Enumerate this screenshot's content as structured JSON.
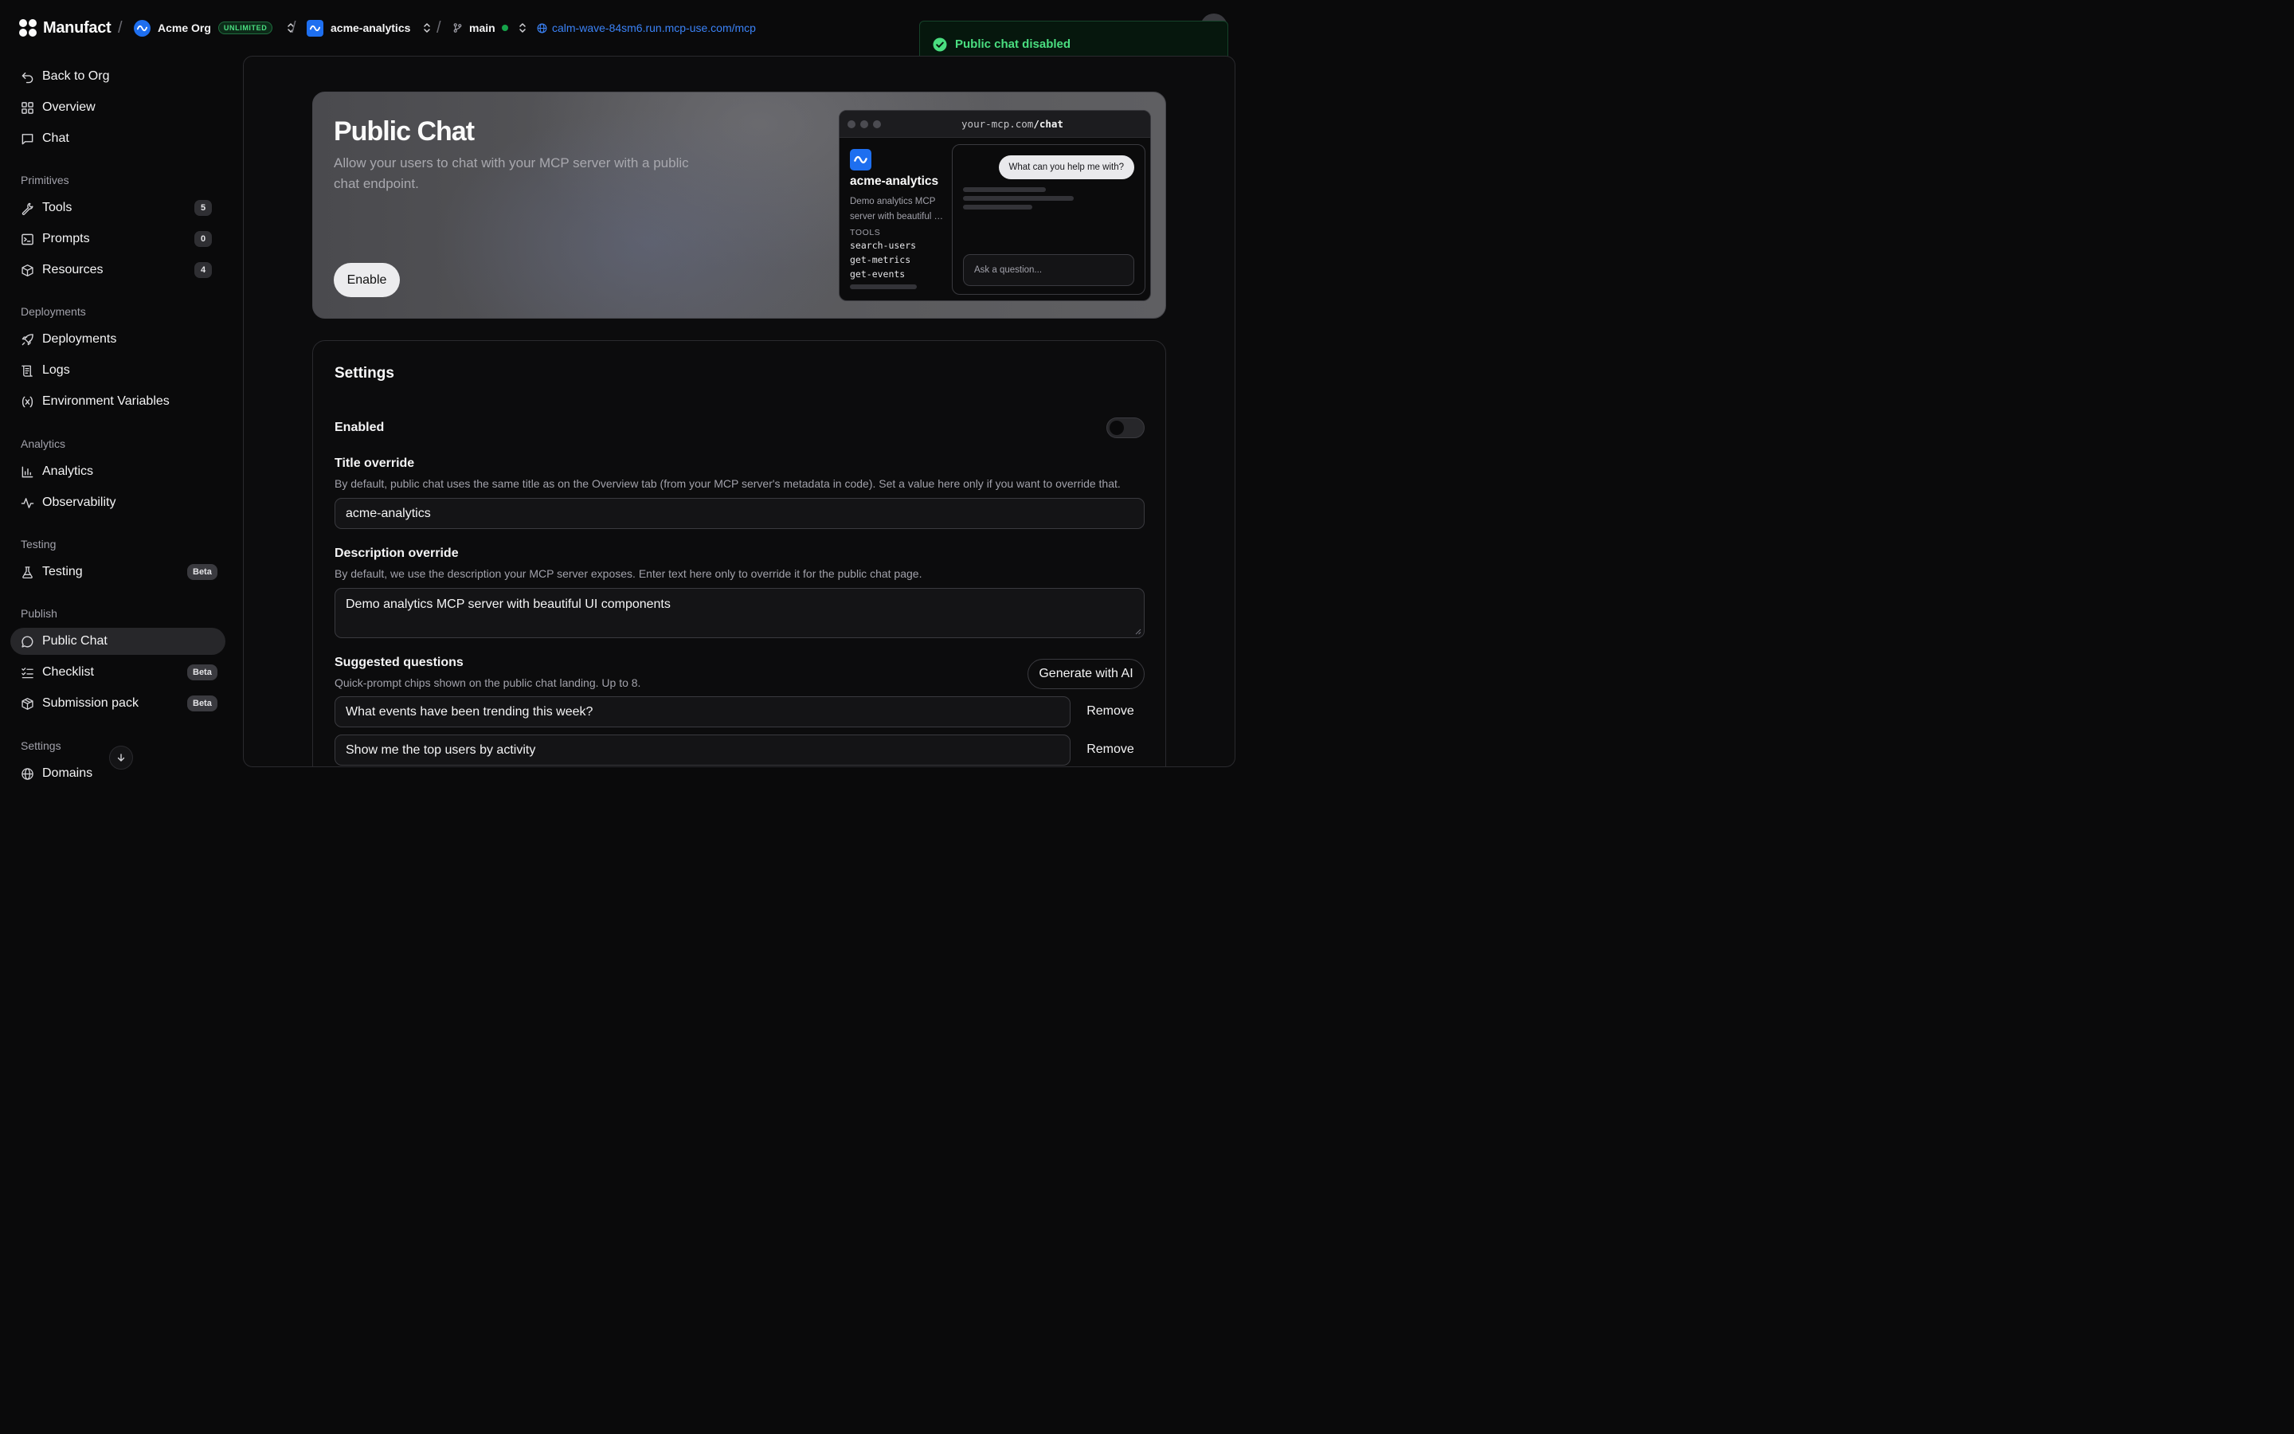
{
  "topbar": {
    "brand": "Manufact",
    "org_name": "Acme Org",
    "plan_badge": "UNLIMITED",
    "project_name": "acme-analytics",
    "branch": "main",
    "server_url": "calm-wave-84sm6.run.mcp-use.com/mcp"
  },
  "toast": {
    "message": "Public chat disabled"
  },
  "sidebar": {
    "top_items": [
      {
        "label": "Back to Org",
        "icon": "back-arrow-icon"
      },
      {
        "label": "Overview",
        "icon": "grid-icon"
      },
      {
        "label": "Chat",
        "icon": "chat-square-icon"
      }
    ],
    "primitives": {
      "heading": "Primitives",
      "items": [
        {
          "label": "Tools",
          "count": "5",
          "icon": "wrench-icon"
        },
        {
          "label": "Prompts",
          "count": "0",
          "icon": "terminal-icon"
        },
        {
          "label": "Resources",
          "count": "4",
          "icon": "box-icon"
        }
      ]
    },
    "deployments": {
      "heading": "Deployments",
      "items": [
        {
          "label": "Deployments",
          "icon": "rocket-icon"
        },
        {
          "label": "Logs",
          "icon": "scroll-icon"
        },
        {
          "label": "Environment Variables",
          "icon": "variable-icon"
        }
      ]
    },
    "analytics": {
      "heading": "Analytics",
      "items": [
        {
          "label": "Analytics",
          "icon": "bar-chart-icon"
        },
        {
          "label": "Observability",
          "icon": "activity-icon"
        }
      ]
    },
    "testing": {
      "heading": "Testing",
      "items": [
        {
          "label": "Testing",
          "badge": "Beta",
          "icon": "flask-icon"
        }
      ]
    },
    "publish": {
      "heading": "Publish",
      "items": [
        {
          "label": "Public Chat",
          "icon": "chat-bubble-icon",
          "active": true
        },
        {
          "label": "Checklist",
          "badge": "Beta",
          "icon": "checklist-icon"
        },
        {
          "label": "Submission pack",
          "badge": "Beta",
          "icon": "package-icon"
        }
      ]
    },
    "settings": {
      "heading": "Settings",
      "items": [
        {
          "label": "Domains",
          "icon": "globe-icon"
        }
      ]
    }
  },
  "hero": {
    "title": "Public Chat",
    "description": "Allow your users to chat with your MCP server with a public chat endpoint.",
    "enable_label": "Enable",
    "preview": {
      "url_prefix": "your-mcp.com",
      "url_path": "/chat",
      "server_name": "acme-analytics",
      "server_desc_line1": "Demo analytics MCP",
      "server_desc_line2": "server with beautiful UI components",
      "tools_heading": "TOOLS",
      "tools": [
        "search-users",
        "get-metrics",
        "get-events"
      ],
      "chat_bubble": "What can you help me with?",
      "input_placeholder": "Ask a question..."
    }
  },
  "settings": {
    "title": "Settings",
    "enabled_label": "Enabled",
    "enabled": false,
    "title_override": {
      "label": "Title override",
      "help": "By default, public chat uses the same title as on the Overview tab (from your MCP server's metadata in code). Set a value here only if you want to override that.",
      "value": "acme-analytics"
    },
    "description_override": {
      "label": "Description override",
      "help": "By default, we use the description your MCP server exposes. Enter text here only to override it for the public chat page.",
      "value": "Demo analytics MCP server with beautiful UI components"
    },
    "suggested_questions": {
      "label": "Suggested questions",
      "help": "Quick-prompt chips shown on the public chat landing. Up to 8.",
      "generate_label": "Generate with AI",
      "remove_label": "Remove",
      "items": [
        "What events have been trending this week?",
        "Show me the top users by activity"
      ]
    }
  },
  "colors": {
    "background": "#0a0a0b",
    "accent_link": "#3b82f6",
    "success": "#4ade80",
    "active_nav": "#27272a"
  }
}
